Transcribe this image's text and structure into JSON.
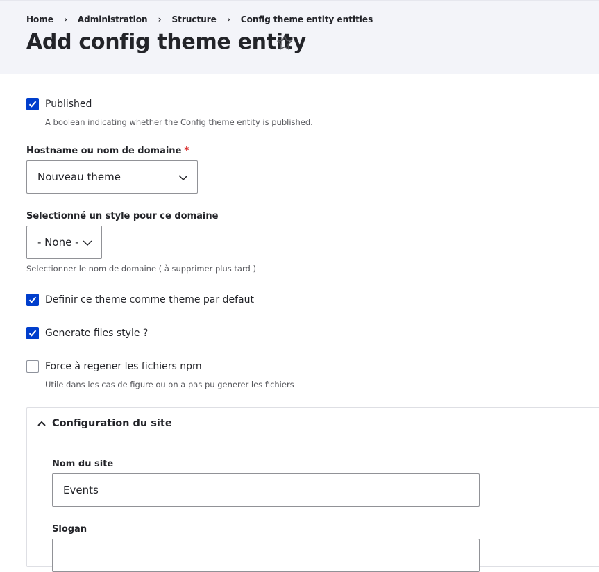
{
  "breadcrumb": {
    "items": [
      "Home",
      "Administration",
      "Structure",
      "Config theme entity entities"
    ],
    "separator": "›"
  },
  "page": {
    "title": "Add config theme entity",
    "favorite_icon": "star-outline-icon"
  },
  "form": {
    "published": {
      "label": "Published",
      "checked": true,
      "description": "A boolean indicating whether the Config theme entity is published."
    },
    "hostname": {
      "label": "Hostname ou nom de domaine",
      "required_marker": "*",
      "value": "Nouveau theme"
    },
    "style": {
      "label": "Selectionné un style pour ce domaine",
      "value": "- None -",
      "description": "Selectionner le nom de domaine ( à supprimer plus tard )"
    },
    "default_theme": {
      "label": "Definir ce theme comme theme par defaut",
      "checked": true
    },
    "generate_files": {
      "label": "Generate files style ?",
      "checked": true
    },
    "force_regen": {
      "label": "Force à regener les fichiers npm",
      "checked": false,
      "description": "Utile dans les cas de figure ou on a pas pu generer les fichiers"
    }
  },
  "site_config": {
    "summary": "Configuration du site",
    "expanded": true,
    "site_name": {
      "label": "Nom du site",
      "value": "Events"
    },
    "slogan": {
      "label": "Slogan",
      "value": ""
    }
  },
  "colors": {
    "accent": "#003ecc",
    "required": "#d72222",
    "header_bg": "#f3f4f9"
  }
}
